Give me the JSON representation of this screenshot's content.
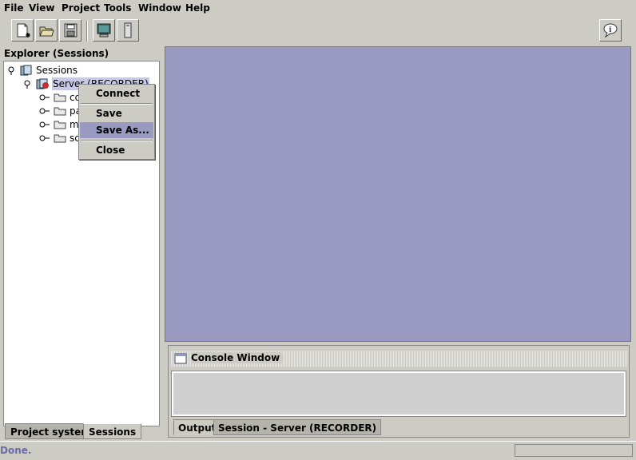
{
  "menu": {
    "file": "File",
    "view": "View",
    "project": "Project",
    "tools": "Tools",
    "window": "Window",
    "help": "Help"
  },
  "toolbar": {
    "icons": [
      "new-document-icon",
      "open-folder-icon",
      "save-disk-icon",
      "monitor-icon",
      "device-icon",
      "help-bubble-icon"
    ]
  },
  "explorer": {
    "title": "Explorer (Sessions)",
    "tree": {
      "root": "Sessions",
      "server": "Server (RECORDER)",
      "children": [
        "con",
        "par",
        "me",
        "scr"
      ]
    },
    "tabs": [
      "Project system",
      "Sessions"
    ],
    "active_tab": "Sessions"
  },
  "context_menu": {
    "items": [
      "Connect",
      "Save",
      "Save As...",
      "Close"
    ],
    "highlighted": "Save As..."
  },
  "console": {
    "title": "Console Window",
    "tabs": [
      "Output",
      "Session - Server (RECORDER)"
    ],
    "active_tab": "Output"
  },
  "status": {
    "text": "Done."
  },
  "colors": {
    "chrome": "#ccccc4",
    "workspace": "#9999c2",
    "menu_highlight": "#9999c2",
    "status_text": "#6a6aa8"
  }
}
